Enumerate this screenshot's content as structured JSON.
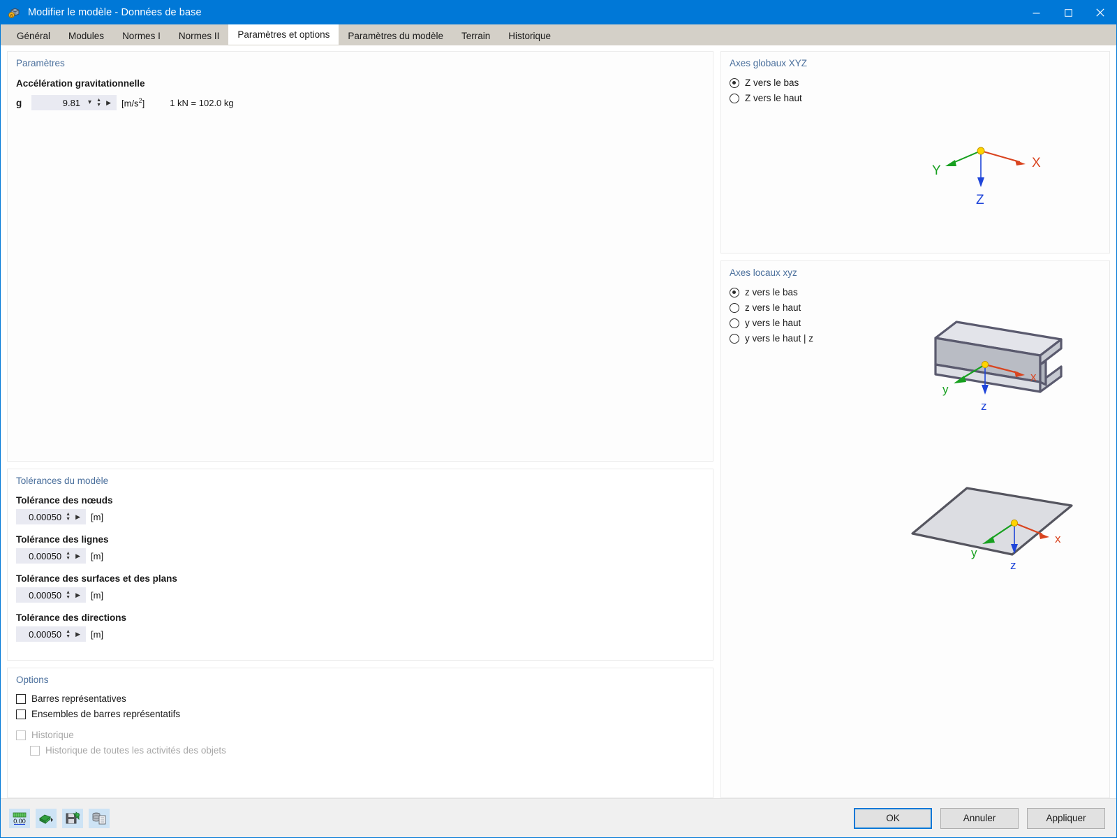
{
  "window": {
    "title": "Modifier le modèle - Données de base",
    "icon": "app-cube-icon",
    "minimize": "–",
    "maximize": "☐",
    "close": "✕",
    "accent": "#0078d7"
  },
  "tabs": [
    {
      "label": "Général",
      "active": false
    },
    {
      "label": "Modules",
      "active": false
    },
    {
      "label": "Normes I",
      "active": false
    },
    {
      "label": "Normes II",
      "active": false
    },
    {
      "label": "Paramètres et options",
      "active": true
    },
    {
      "label": "Paramètres du modèle",
      "active": false
    },
    {
      "label": "Terrain",
      "active": false
    },
    {
      "label": "Historique",
      "active": false
    }
  ],
  "parameters": {
    "panel_title": "Paramètres",
    "gravity_label": "Accélération gravitationnelle",
    "g_symbol": "g",
    "g_value": "9.81",
    "g_unit_prefix": "[m/s",
    "g_unit_exp": "2",
    "g_unit_suffix": "]",
    "conversion_note": "1 kN = 102.0 kg"
  },
  "tolerances": {
    "panel_title": "Tolérances du modèle",
    "items": [
      {
        "label": "Tolérance des nœuds",
        "value": "0.00050",
        "unit": "[m]"
      },
      {
        "label": "Tolérance des lignes",
        "value": "0.00050",
        "unit": "[m]"
      },
      {
        "label": "Tolérance des surfaces et des plans",
        "value": "0.00050",
        "unit": "[m]"
      },
      {
        "label": "Tolérance des directions",
        "value": "0.00050",
        "unit": "[m]"
      }
    ]
  },
  "options": {
    "panel_title": "Options",
    "items": [
      {
        "label": "Barres représentatives",
        "checked": false,
        "disabled": false,
        "indent": 0
      },
      {
        "label": "Ensembles de barres représentatifs",
        "checked": false,
        "disabled": false,
        "indent": 0
      },
      {
        "label": "Historique",
        "checked": false,
        "disabled": true,
        "indent": 0
      },
      {
        "label": "Historique de toutes les activités des objets",
        "checked": false,
        "disabled": true,
        "indent": 1
      }
    ]
  },
  "global_axes": {
    "panel_title": "Axes globaux XYZ",
    "options": [
      {
        "label": "Z vers le bas",
        "selected": true
      },
      {
        "label": "Z vers le haut",
        "selected": false
      }
    ],
    "diagram": {
      "name": "global-axes-diagram",
      "x_label": "X",
      "y_label": "Y",
      "z_label": "Z",
      "x_color": "#d9441f",
      "y_color": "#17a01f",
      "z_color": "#1f45d9",
      "origin_color": "#ffd400"
    }
  },
  "local_axes": {
    "panel_title": "Axes locaux xyz",
    "options": [
      {
        "label": "z vers le bas",
        "selected": true
      },
      {
        "label": "z vers le haut",
        "selected": false
      },
      {
        "label": "y vers le haut",
        "selected": false
      },
      {
        "label": "y vers le haut | z",
        "selected": false
      }
    ],
    "beam_diagram": {
      "name": "i-beam-local-axes-diagram",
      "x_label": "x",
      "y_label": "y",
      "z_label": "z"
    },
    "surface_diagram": {
      "name": "surface-local-axes-diagram",
      "x_label": "x",
      "y_label": "y",
      "z_label": "z"
    }
  },
  "footer": {
    "tools": [
      {
        "name": "units-settings-icon",
        "glyph": "0.00"
      },
      {
        "name": "import-defaults-icon",
        "glyph": ""
      },
      {
        "name": "save-defaults-icon",
        "glyph": ""
      },
      {
        "name": "database-export-icon",
        "glyph": ""
      }
    ],
    "buttons": [
      {
        "label": "OK",
        "primary": true
      },
      {
        "label": "Annuler",
        "primary": false
      },
      {
        "label": "Appliquer",
        "primary": false
      }
    ]
  }
}
